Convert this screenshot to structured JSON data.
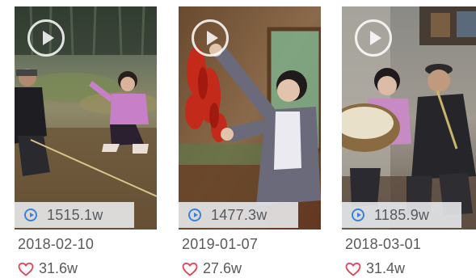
{
  "videos": [
    {
      "views": "1515.1w",
      "date": "2018-02-10",
      "likes": "31.6w"
    },
    {
      "views": "1477.3w",
      "date": "2019-01-07",
      "likes": "27.6w"
    },
    {
      "views": "1185.9w",
      "date": "2018-03-01",
      "likes": "31.4w"
    }
  ],
  "icons": {
    "play": "play-circle-icon",
    "views": "play-count-icon",
    "likes": "heart-icon"
  },
  "colors": {
    "views_icon": "#3b82d6",
    "heart": "#e0455a",
    "text": "#5a5a5a"
  }
}
